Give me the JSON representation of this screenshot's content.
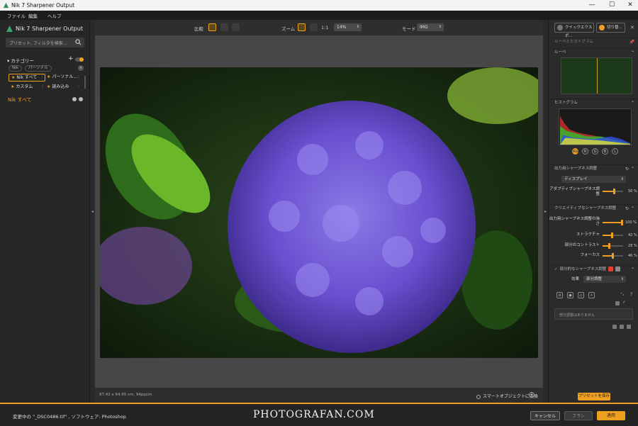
{
  "window": {
    "title": "Nik 7 Sharpener Output",
    "min": "—",
    "max": "☐",
    "close": "✕"
  },
  "menu": [
    "ファイル",
    "編集",
    "ヘルプ"
  ],
  "left": {
    "app_name": "Nik 7 Sharpener Output",
    "search_placeholder": "プリセット, フィルタを検索...",
    "category_label": "カテゴリー",
    "chips": [
      "Nik",
      "パーソナル"
    ],
    "categories": [
      {
        "label": "Nik すべて",
        "selected": true
      },
      {
        "label": "パーソナル...",
        "selected": false
      },
      {
        "label": "カスタム",
        "selected": false
      },
      {
        "label": "読み込み",
        "selected": false
      }
    ],
    "subheading": "Nik すべて"
  },
  "toolbar": {
    "compare_label": "比較",
    "zoom_label": "ズーム",
    "zoom_one": "1:1",
    "zoom_value": "14%",
    "mode_label": "モード",
    "mode_value": "IMG"
  },
  "status": {
    "dimensions": "97.42 x 64.95 cm, 94ppcm",
    "smart_object": "スマートオブジェクトに変換"
  },
  "right": {
    "quick_export": "クイックエクスポ...",
    "switch": "切り替...",
    "section_loupe_histogram": "ルーペとヒストグラム",
    "loupe": "ルーペ",
    "histogram": "ヒストグラム",
    "channels": [
      "RGB",
      "R",
      "G",
      "B",
      "L"
    ],
    "output_section": "出力用シャープネス調整",
    "display_value": "ディスプレイ",
    "adaptive_label": "アダプティブシャープネス調整",
    "adaptive_value": "50 %",
    "creative_section": "クリエイティブなシャープネス調整",
    "output_strength_label": "出力用シャープネス調整の強さ",
    "output_strength_value": "100 %",
    "structure_label": "ストラクチャ",
    "structure_value": "42 %",
    "local_contrast_label": "部分のコントラスト",
    "local_contrast_value": "28 %",
    "focus_label": "フォーカス",
    "focus_value": "46 %",
    "local_section": "部分的なシャープネス調整",
    "effect_label": "効果",
    "effect_value": "部分調整",
    "no_local": "部分調整はありません",
    "save_preset": "プリセットを保存"
  },
  "sliders": {
    "adaptive": 50,
    "output_strength": 100,
    "structure": 42,
    "local_contrast": 28,
    "focus": 46
  },
  "footer": {
    "editing_text": "変更中の \"_DSC0486.tif\" , ソフトウェア: Photoshop",
    "watermark": "PHOTOGRAFAN.COM",
    "cancel": "キャンセル",
    "brush": "ブラシ",
    "apply": "適用"
  },
  "colors": {
    "accent": "#f0a020",
    "panel": "#262626",
    "canvas": "#474747"
  }
}
